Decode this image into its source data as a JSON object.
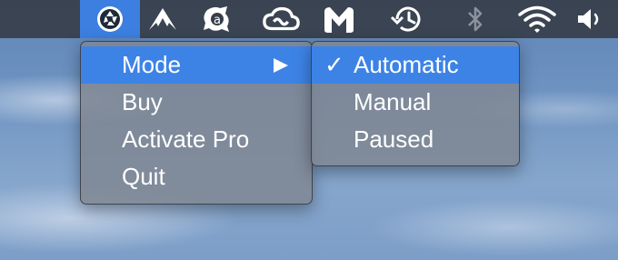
{
  "menubar": {
    "icons": [
      {
        "name": "aperture-app-icon",
        "active": true
      },
      {
        "name": "nordvpn-icon"
      },
      {
        "name": "avast-icon"
      },
      {
        "name": "creative-cloud-icon"
      },
      {
        "name": "malwarebytes-icon"
      },
      {
        "name": "time-machine-icon"
      },
      {
        "name": "bluetooth-icon"
      },
      {
        "name": "wifi-icon"
      },
      {
        "name": "volume-icon"
      }
    ]
  },
  "main_menu": {
    "items": [
      {
        "label": "Mode",
        "highlighted": true,
        "has_submenu": true
      },
      {
        "label": "Buy"
      },
      {
        "label": "Activate Pro"
      },
      {
        "label": "Quit"
      }
    ]
  },
  "submenu": {
    "check_glyph": "✓",
    "items": [
      {
        "label": "Automatic",
        "checked": true,
        "highlighted": true
      },
      {
        "label": "Manual"
      },
      {
        "label": "Paused"
      }
    ]
  },
  "colors": {
    "highlight": "#3d83e6",
    "menubar": "#373e4a",
    "menu_bg": "#808894"
  }
}
